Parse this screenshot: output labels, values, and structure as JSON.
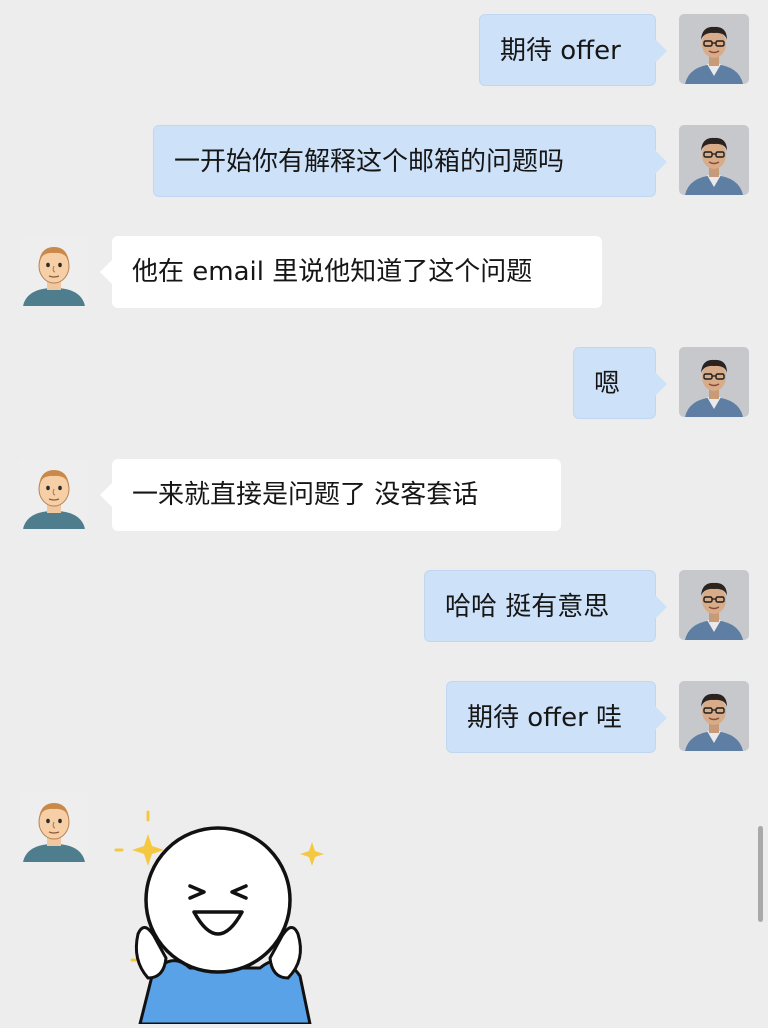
{
  "messages": [
    {
      "side": "right",
      "text": "期待 offer"
    },
    {
      "side": "right",
      "text": "一开始你有解释这个邮箱的问题吗"
    },
    {
      "side": "left",
      "text": "他在 email 里说他知道了这个问题"
    },
    {
      "side": "right",
      "text": "嗯"
    },
    {
      "side": "left",
      "text": "一来就直接是问题了 没客套话"
    },
    {
      "side": "right",
      "text": "哈哈 挺有意思"
    },
    {
      "side": "right",
      "text": "期待 offer 哇"
    }
  ],
  "sticker": {
    "type": "sticker",
    "description": "smiling-face-sticker"
  },
  "colors": {
    "background": "#ededed",
    "sent_bubble": "#cde1f8",
    "received_bubble": "#ffffff"
  }
}
